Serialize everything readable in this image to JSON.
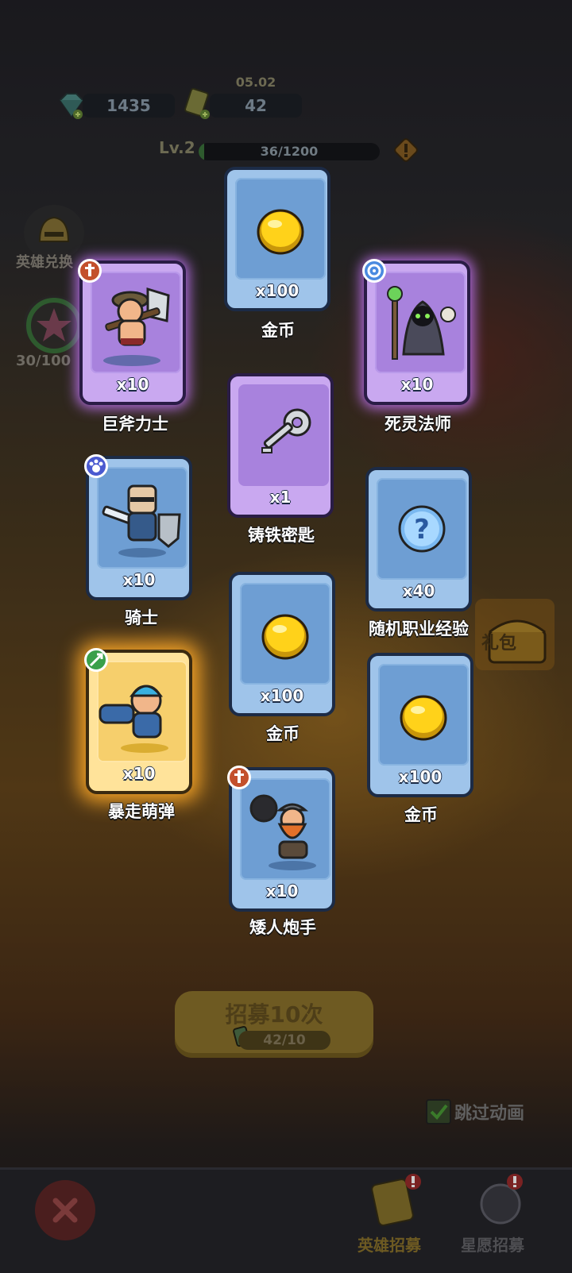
{
  "hud": {
    "date": "05.02",
    "gems": "1435",
    "tickets": "42",
    "level": "Lv.2",
    "xp_text": "36/1200",
    "xp_fraction": 0.03
  },
  "side": {
    "hero_exchange": "英雄兑换",
    "star_progress": "30/100"
  },
  "cards": [
    {
      "id": "gold1",
      "qty": "x100",
      "name": "金币"
    },
    {
      "id": "axe",
      "qty": "x10",
      "name": "巨斧力士"
    },
    {
      "id": "necro",
      "qty": "x10",
      "name": "死灵法师"
    },
    {
      "id": "key",
      "qty": "x1",
      "name": "铸铁密匙"
    },
    {
      "id": "knight",
      "qty": "x10",
      "name": "骑士"
    },
    {
      "id": "exp",
      "qty": "x40",
      "name": "随机职业经验"
    },
    {
      "id": "gold2",
      "qty": "x100",
      "name": "金币"
    },
    {
      "id": "bomber",
      "qty": "x10",
      "name": "暴走萌弹"
    },
    {
      "id": "gold3",
      "qty": "x100",
      "name": "金币"
    },
    {
      "id": "dwarf",
      "qty": "x10",
      "name": "矮人炮手"
    }
  ],
  "recruit": {
    "label": "招募10次",
    "count": "42/10"
  },
  "skip_label": "跳过动画",
  "chest_text": "礼包",
  "tabs": {
    "hero_recruit": "英雄招募",
    "wish_recruit": "星愿招募"
  },
  "colors": {
    "blue_card": "#9fc4ea",
    "purple_card": "#c9a8f0",
    "gold_card": "#ffe39a"
  }
}
